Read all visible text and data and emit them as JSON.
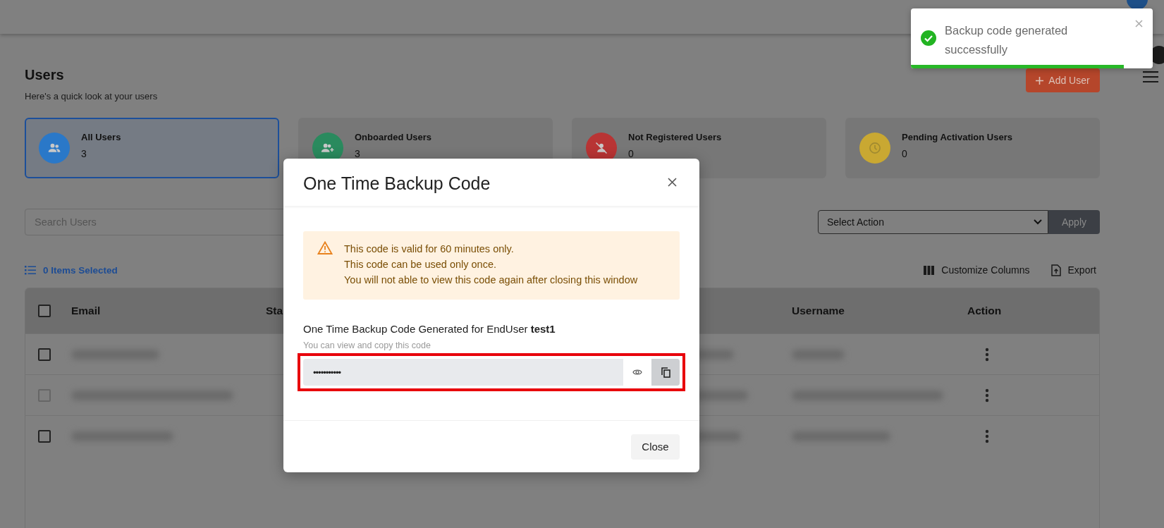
{
  "page": {
    "title": "Users",
    "subtitle": "Here's a quick look at your users",
    "add_button": "Add User"
  },
  "stat_cards": [
    {
      "kind": "users",
      "label": "All Users",
      "count": "3",
      "selected": true,
      "color": "#2a78c8"
    },
    {
      "kind": "user-plus",
      "label": "Onboarded Users",
      "count": "3",
      "selected": false,
      "color": "#2a8a5e"
    },
    {
      "kind": "user-off",
      "label": "Not Registered Users",
      "count": "0",
      "selected": false,
      "color": "#b83434"
    },
    {
      "kind": "clock",
      "label": "Pending Activation Users",
      "count": "0",
      "selected": false,
      "color": "#c9a832"
    }
  ],
  "search": {
    "placeholder": "Search Users"
  },
  "bulk_action": {
    "select": "Select Action",
    "apply": "Apply"
  },
  "selection": {
    "label": "0 Items Selected"
  },
  "table_tools": [
    {
      "kind": "columns",
      "label": "Customize Columns"
    },
    {
      "kind": "export",
      "label": "Export"
    }
  ],
  "table": {
    "select_all_checked": false,
    "columns": [
      "Email",
      "Sta",
      "Username",
      "Action"
    ],
    "rows": [
      {
        "checked": false,
        "disabled": false
      },
      {
        "checked": false,
        "disabled": true
      },
      {
        "checked": false,
        "disabled": false
      }
    ]
  },
  "modal": {
    "title": "One Time Backup Code",
    "notice": [
      "This code is valid for 60 minutes only.",
      "This code can be used only once.",
      "You will not able to view this code again after closing this window"
    ],
    "label": "One Time Backup Code Generated for EndUser **test1**",
    "hint": "You can view and copy this code",
    "code": "•••••••••••",
    "highlighted": true,
    "close_button": "Close"
  },
  "toast": {
    "message": "Backup code generated successfully",
    "level": 0.88
  }
}
